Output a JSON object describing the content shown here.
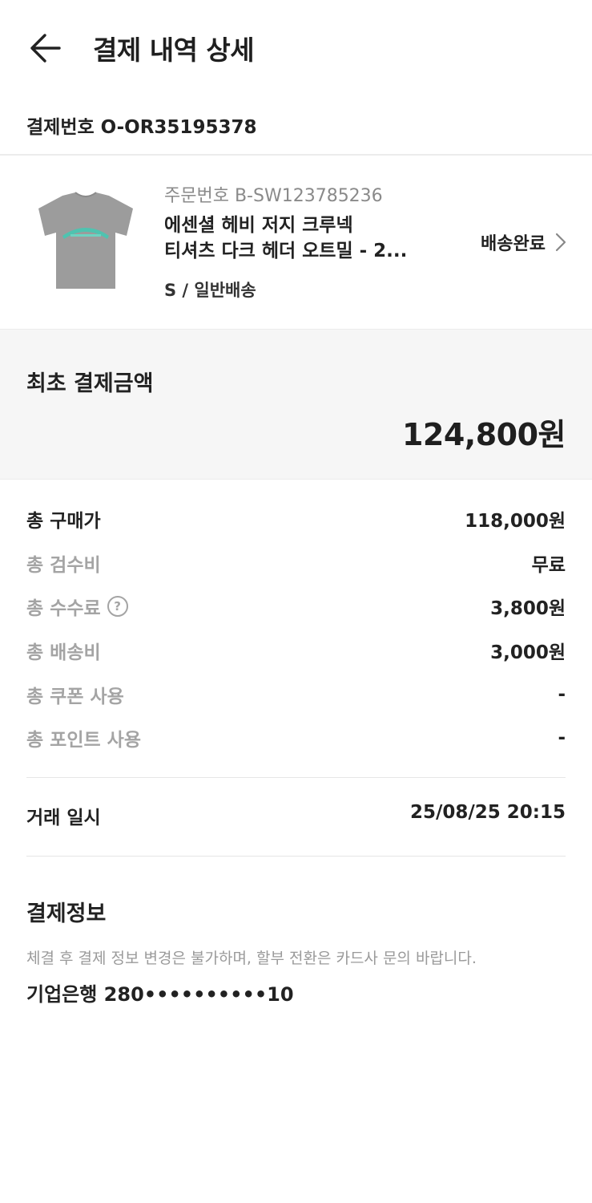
{
  "header": {
    "title": "결제 내역 상세"
  },
  "payment": {
    "label": "결제번호",
    "number": "O-OR35195378"
  },
  "product": {
    "order_no": "주문번호 B-SW123785236",
    "name_line1": "에센셜 헤비 저지 크루넥",
    "name_line2": "티셔츠 다크 헤더 오트밀 - 2...",
    "option": "S / 일반배송",
    "status": "배송완료"
  },
  "total": {
    "label": "최초 결제금액",
    "value": "124,800원"
  },
  "breakdown": [
    {
      "label": "총 구매가",
      "value": "118,000원"
    },
    {
      "label": "총 검수비",
      "value": "무료"
    },
    {
      "label": "총 수수료",
      "value": "3,800원"
    },
    {
      "label": "총 배송비",
      "value": "3,000원"
    },
    {
      "label": "총 쿠폰 사용",
      "value": "-"
    },
    {
      "label": "총 포인트 사용",
      "value": "-"
    }
  ],
  "trade": {
    "label": "거래 일시",
    "value": "25/08/25 20:15"
  },
  "payinfo": {
    "title": "결제정보",
    "note": "체결 후 결제 정보 변경은 불가하며, 할부 전환은 카드사 문의 바랍니다.",
    "method": "기업은행 280••••••••••10"
  },
  "colors": {
    "thumb_shirt": "#9a9a9a",
    "thumb_print": "#4fc3b0",
    "muted": "#a4a4a4",
    "panel": "#f6f6f6"
  },
  "icons": {
    "back": "arrow-left-icon",
    "status": "chevron-right-icon",
    "help": "question-circle-icon"
  }
}
